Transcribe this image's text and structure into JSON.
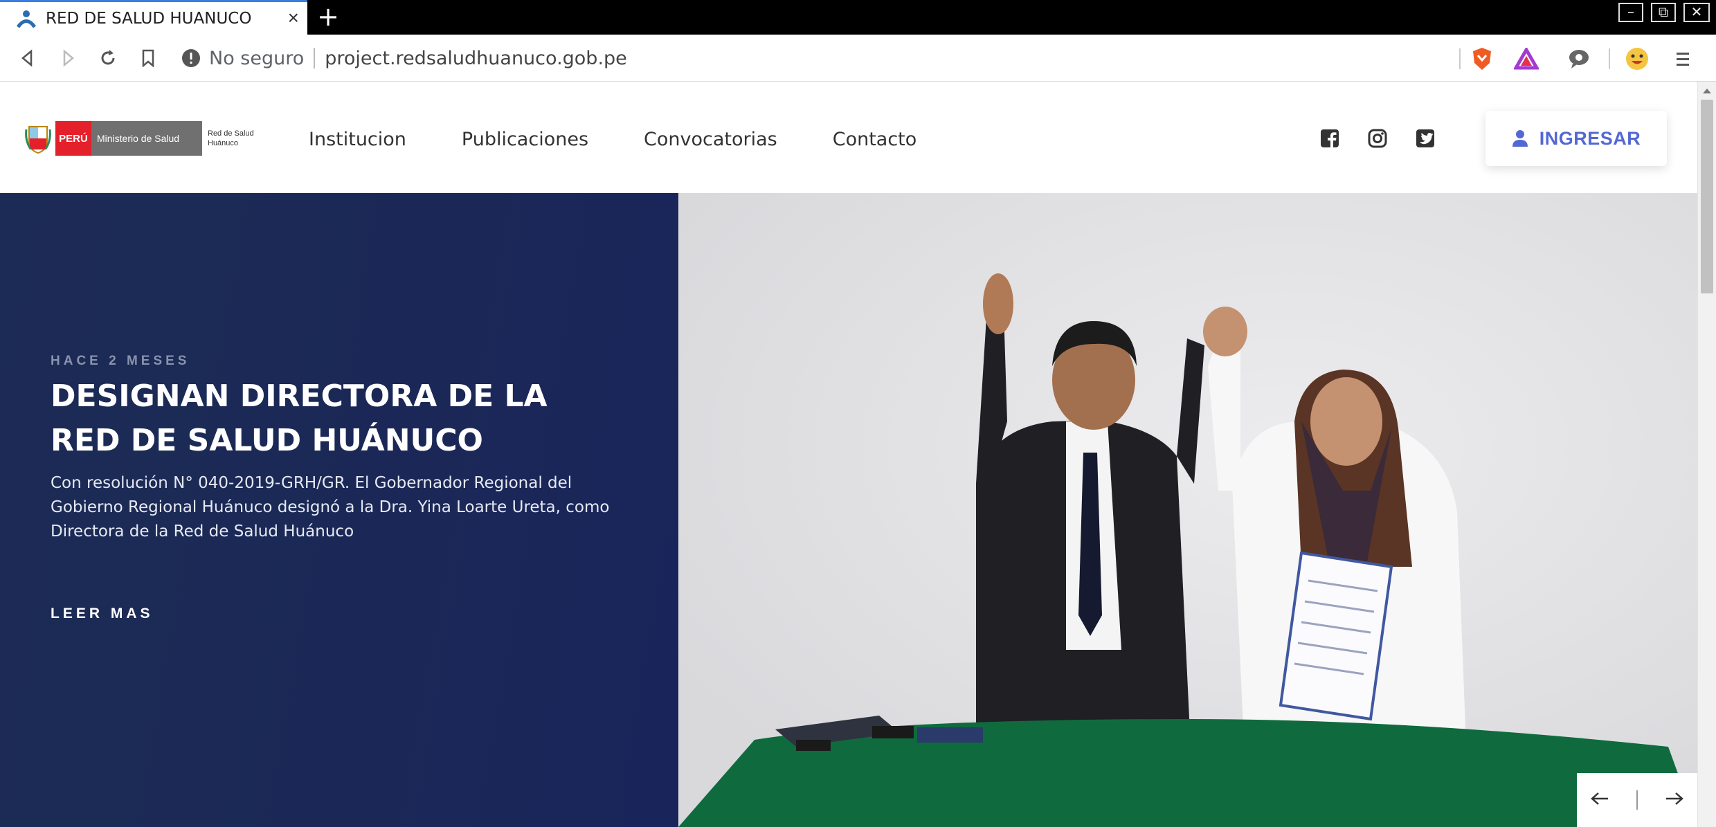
{
  "browser": {
    "tab_title": "RED DE SALUD HUANUCO",
    "tab_close": "×",
    "new_tab": "+",
    "security_label": "No seguro",
    "url": "project.redsaludhuanuco.gob.pe",
    "window_controls": {
      "minimize": "–",
      "restore": "⧉",
      "close": "✕"
    },
    "extensions": [
      "brave-shield-icon",
      "brave-rewards-icon",
      "speech-icon",
      "profile-avatar-icon",
      "menu-icon"
    ]
  },
  "site": {
    "logo": {
      "peru": "PERÚ",
      "ministry": "Ministerio de Salud",
      "red": "Red de Salud Huánuco"
    },
    "nav": [
      "Institucion",
      "Publicaciones",
      "Convocatorias",
      "Contacto"
    ],
    "social": [
      "facebook-icon",
      "instagram-icon",
      "twitter-icon"
    ],
    "login_label": "INGRESAR"
  },
  "hero": {
    "time": "HACE 2 MESES",
    "title": "DESIGNAN DIRECTORA DE LA RED DE SALUD HUÁNUCO",
    "text": "Con resolución N° 040-2019-GRH/GR. El Gobernador Regional del Gobierno Regional Huánuco designó a la Dra. Yina Loarte Ureta, como Directora de la Red de Salud Huánuco",
    "more": "LEER MAS"
  },
  "colors": {
    "hero_bg": "#1b2857",
    "accent": "#5468d4",
    "peru_red": "#e4202a",
    "minsa_gray": "#707070"
  }
}
